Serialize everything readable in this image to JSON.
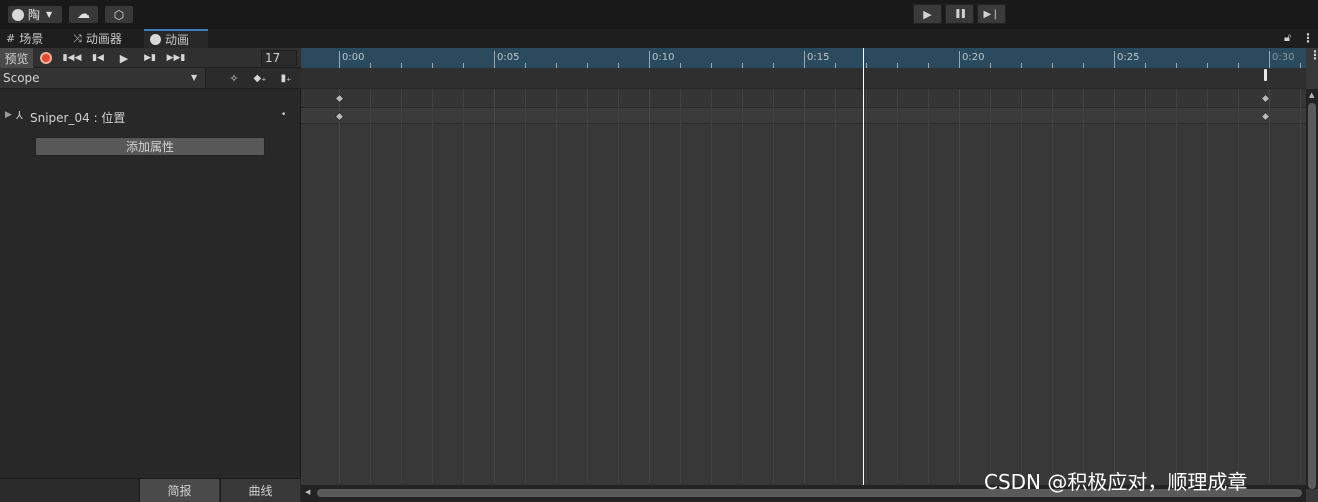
{
  "toolbar": {
    "account_label": "陶",
    "play_label": "▶",
    "pause_label": "❚❚",
    "step_label": "▶❘"
  },
  "tabs": [
    {
      "label": "场景",
      "icon": "grid-icon"
    },
    {
      "label": "动画器",
      "icon": "animator-icon"
    },
    {
      "label": "动画",
      "icon": "clock-icon"
    }
  ],
  "controls": {
    "preview_label": "预览",
    "frame_value": "17",
    "clip_name": "Scope"
  },
  "property": {
    "name": "Sniper_04 : 位置",
    "add_label": "添加属性"
  },
  "ruler": {
    "labels": [
      "0:00",
      "0:05",
      "0:10",
      "0:15",
      "0:20",
      "0:25",
      "0:30"
    ]
  },
  "bottom_tabs": {
    "dopesheet_label": "简报",
    "curves_label": "曲线"
  },
  "watermark": "CSDN @积极应对，顺理成章",
  "colors": {
    "record": "#e04a2c",
    "accent_tab": "#3a79bb",
    "ruler_bg": "#2b4a5e",
    "playhead": "#ffffff"
  }
}
